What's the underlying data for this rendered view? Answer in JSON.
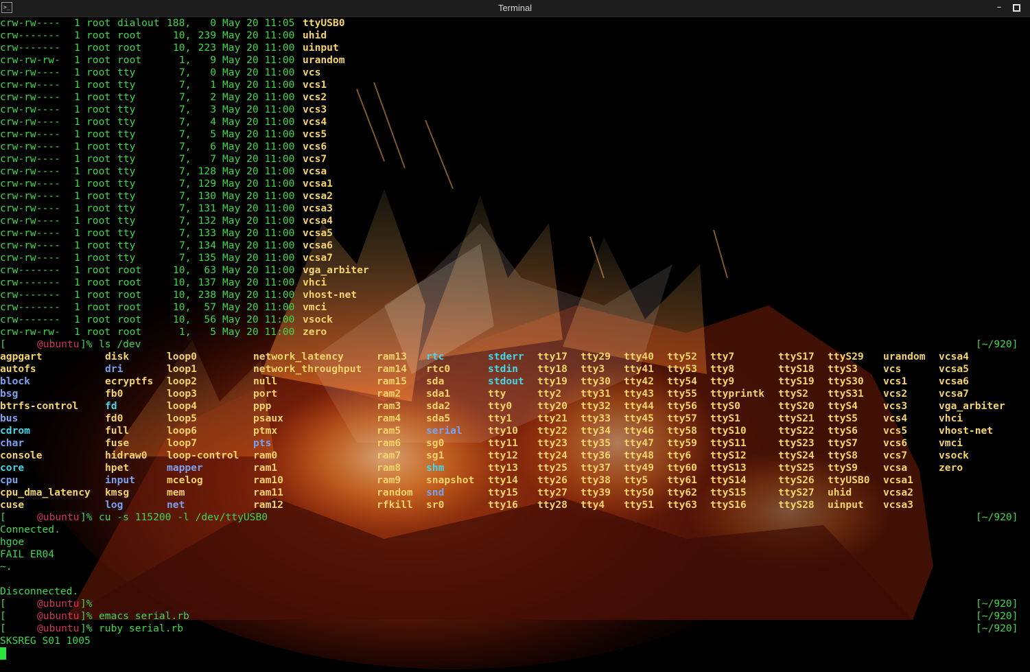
{
  "window": {
    "title": "Terminal",
    "app_icon": "terminal-icon",
    "minimize_glyph": "–"
  },
  "colors": {
    "green": "#3fd84a",
    "yellow": "#f4d36b",
    "blue": "#7aa2f0",
    "cyan": "#47d6e8",
    "magenta": "#d3325d",
    "white": "#f2f2f2"
  },
  "ls_long": [
    {
      "perm": "crw-rw----",
      "links": "1",
      "owner": "root",
      "group": "dialout",
      "major": "188,",
      "minor": "0",
      "date": "May 20 11:05",
      "name": "ttyUSB0"
    },
    {
      "perm": "crw-------",
      "links": "1",
      "owner": "root",
      "group": "root",
      "major": "10,",
      "minor": "239",
      "date": "May 20 11:00",
      "name": "uhid"
    },
    {
      "perm": "crw-------",
      "links": "1",
      "owner": "root",
      "group": "root",
      "major": "10,",
      "minor": "223",
      "date": "May 20 11:00",
      "name": "uinput"
    },
    {
      "perm": "crw-rw-rw-",
      "links": "1",
      "owner": "root",
      "group": "root",
      "major": "1,",
      "minor": "9",
      "date": "May 20 11:00",
      "name": "urandom"
    },
    {
      "perm": "crw-rw----",
      "links": "1",
      "owner": "root",
      "group": "tty",
      "major": "7,",
      "minor": "0",
      "date": "May 20 11:00",
      "name": "vcs"
    },
    {
      "perm": "crw-rw----",
      "links": "1",
      "owner": "root",
      "group": "tty",
      "major": "7,",
      "minor": "1",
      "date": "May 20 11:00",
      "name": "vcs1"
    },
    {
      "perm": "crw-rw----",
      "links": "1",
      "owner": "root",
      "group": "tty",
      "major": "7,",
      "minor": "2",
      "date": "May 20 11:00",
      "name": "vcs2"
    },
    {
      "perm": "crw-rw----",
      "links": "1",
      "owner": "root",
      "group": "tty",
      "major": "7,",
      "minor": "3",
      "date": "May 20 11:00",
      "name": "vcs3"
    },
    {
      "perm": "crw-rw----",
      "links": "1",
      "owner": "root",
      "group": "tty",
      "major": "7,",
      "minor": "4",
      "date": "May 20 11:00",
      "name": "vcs4"
    },
    {
      "perm": "crw-rw----",
      "links": "1",
      "owner": "root",
      "group": "tty",
      "major": "7,",
      "minor": "5",
      "date": "May 20 11:00",
      "name": "vcs5"
    },
    {
      "perm": "crw-rw----",
      "links": "1",
      "owner": "root",
      "group": "tty",
      "major": "7,",
      "minor": "6",
      "date": "May 20 11:00",
      "name": "vcs6"
    },
    {
      "perm": "crw-rw----",
      "links": "1",
      "owner": "root",
      "group": "tty",
      "major": "7,",
      "minor": "7",
      "date": "May 20 11:00",
      "name": "vcs7"
    },
    {
      "perm": "crw-rw----",
      "links": "1",
      "owner": "root",
      "group": "tty",
      "major": "7,",
      "minor": "128",
      "date": "May 20 11:00",
      "name": "vcsa"
    },
    {
      "perm": "crw-rw----",
      "links": "1",
      "owner": "root",
      "group": "tty",
      "major": "7,",
      "minor": "129",
      "date": "May 20 11:00",
      "name": "vcsa1"
    },
    {
      "perm": "crw-rw----",
      "links": "1",
      "owner": "root",
      "group": "tty",
      "major": "7,",
      "minor": "130",
      "date": "May 20 11:00",
      "name": "vcsa2"
    },
    {
      "perm": "crw-rw----",
      "links": "1",
      "owner": "root",
      "group": "tty",
      "major": "7,",
      "minor": "131",
      "date": "May 20 11:00",
      "name": "vcsa3"
    },
    {
      "perm": "crw-rw----",
      "links": "1",
      "owner": "root",
      "group": "tty",
      "major": "7,",
      "minor": "132",
      "date": "May 20 11:00",
      "name": "vcsa4"
    },
    {
      "perm": "crw-rw----",
      "links": "1",
      "owner": "root",
      "group": "tty",
      "major": "7,",
      "minor": "133",
      "date": "May 20 11:00",
      "name": "vcsa5"
    },
    {
      "perm": "crw-rw----",
      "links": "1",
      "owner": "root",
      "group": "tty",
      "major": "7,",
      "minor": "134",
      "date": "May 20 11:00",
      "name": "vcsa6"
    },
    {
      "perm": "crw-rw----",
      "links": "1",
      "owner": "root",
      "group": "tty",
      "major": "7,",
      "minor": "135",
      "date": "May 20 11:00",
      "name": "vcsa7"
    },
    {
      "perm": "crw-------",
      "links": "1",
      "owner": "root",
      "group": "root",
      "major": "10,",
      "minor": "63",
      "date": "May 20 11:00",
      "name": "vga_arbiter"
    },
    {
      "perm": "crw-------",
      "links": "1",
      "owner": "root",
      "group": "root",
      "major": "10,",
      "minor": "137",
      "date": "May 20 11:00",
      "name": "vhci"
    },
    {
      "perm": "crw-------",
      "links": "1",
      "owner": "root",
      "group": "root",
      "major": "10,",
      "minor": "238",
      "date": "May 20 11:00",
      "name": "vhost-net"
    },
    {
      "perm": "crw-------",
      "links": "1",
      "owner": "root",
      "group": "root",
      "major": "10,",
      "minor": "57",
      "date": "May 20 11:00",
      "name": "vmci"
    },
    {
      "perm": "crw-------",
      "links": "1",
      "owner": "root",
      "group": "root",
      "major": "10,",
      "minor": "56",
      "date": "May 20 11:00",
      "name": "vsock"
    },
    {
      "perm": "crw-rw-rw-",
      "links": "1",
      "owner": "root",
      "group": "root",
      "major": "1,",
      "minor": "5",
      "date": "May 20 11:00",
      "name": "zero"
    }
  ],
  "prompt": {
    "open": "[",
    "host": "@ubuntu",
    "close": "]%",
    "right": "[~/920]"
  },
  "cmd_ls": "ls /dev",
  "ls_grid": [
    [
      [
        "agpgart",
        "y"
      ],
      [
        "disk",
        "y"
      ],
      [
        "loop0",
        "y"
      ],
      [
        "network_latency",
        "y"
      ],
      [
        "ram13",
        "y"
      ],
      [
        "rtc",
        "c"
      ],
      [
        "stderr",
        "c"
      ],
      [
        "tty17",
        "y"
      ],
      [
        "tty29",
        "y"
      ],
      [
        "tty40",
        "y"
      ],
      [
        "tty52",
        "y"
      ],
      [
        "tty7",
        "y"
      ],
      [
        "ttyS17",
        "y"
      ],
      [
        "ttyS29",
        "y"
      ],
      [
        "urandom",
        "y"
      ],
      [
        "vcsa4",
        "y"
      ]
    ],
    [
      [
        "autofs",
        "y"
      ],
      [
        "dri",
        "b"
      ],
      [
        "loop1",
        "y"
      ],
      [
        "network_throughput",
        "y"
      ],
      [
        "ram14",
        "y"
      ],
      [
        "rtc0",
        "y"
      ],
      [
        "stdin",
        "c"
      ],
      [
        "tty18",
        "y"
      ],
      [
        "tty3",
        "y"
      ],
      [
        "tty41",
        "y"
      ],
      [
        "tty53",
        "y"
      ],
      [
        "tty8",
        "y"
      ],
      [
        "ttyS18",
        "y"
      ],
      [
        "ttyS3",
        "y"
      ],
      [
        "vcs",
        "y"
      ],
      [
        "vcsa5",
        "y"
      ]
    ],
    [
      [
        "block",
        "b"
      ],
      [
        "ecryptfs",
        "y"
      ],
      [
        "loop2",
        "y"
      ],
      [
        "null",
        "y"
      ],
      [
        "ram15",
        "y"
      ],
      [
        "sda",
        "y"
      ],
      [
        "stdout",
        "c"
      ],
      [
        "tty19",
        "y"
      ],
      [
        "tty30",
        "y"
      ],
      [
        "tty42",
        "y"
      ],
      [
        "tty54",
        "y"
      ],
      [
        "tty9",
        "y"
      ],
      [
        "ttyS19",
        "y"
      ],
      [
        "ttyS30",
        "y"
      ],
      [
        "vcs1",
        "y"
      ],
      [
        "vcsa6",
        "y"
      ]
    ],
    [
      [
        "bsg",
        "b"
      ],
      [
        "fb0",
        "y"
      ],
      [
        "loop3",
        "y"
      ],
      [
        "port",
        "y"
      ],
      [
        "ram2",
        "y"
      ],
      [
        "sda1",
        "y"
      ],
      [
        "tty",
        "y"
      ],
      [
        "tty2",
        "y"
      ],
      [
        "tty31",
        "y"
      ],
      [
        "tty43",
        "y"
      ],
      [
        "tty55",
        "y"
      ],
      [
        "ttyprintk",
        "y"
      ],
      [
        "ttyS2",
        "y"
      ],
      [
        "ttyS31",
        "y"
      ],
      [
        "vcs2",
        "y"
      ],
      [
        "vcsa7",
        "y"
      ]
    ],
    [
      [
        "btrfs-control",
        "y"
      ],
      [
        "fd",
        "c"
      ],
      [
        "loop4",
        "y"
      ],
      [
        "ppp",
        "y"
      ],
      [
        "ram3",
        "y"
      ],
      [
        "sda2",
        "y"
      ],
      [
        "tty0",
        "y"
      ],
      [
        "tty20",
        "y"
      ],
      [
        "tty32",
        "y"
      ],
      [
        "tty44",
        "y"
      ],
      [
        "tty56",
        "y"
      ],
      [
        "ttyS0",
        "y"
      ],
      [
        "ttyS20",
        "y"
      ],
      [
        "ttyS4",
        "y"
      ],
      [
        "vcs3",
        "y"
      ],
      [
        "vga_arbiter",
        "y"
      ]
    ],
    [
      [
        "bus",
        "b"
      ],
      [
        "fd0",
        "y"
      ],
      [
        "loop5",
        "y"
      ],
      [
        "psaux",
        "y"
      ],
      [
        "ram4",
        "y"
      ],
      [
        "sda5",
        "y"
      ],
      [
        "tty1",
        "y"
      ],
      [
        "tty21",
        "y"
      ],
      [
        "tty33",
        "y"
      ],
      [
        "tty45",
        "y"
      ],
      [
        "tty57",
        "y"
      ],
      [
        "ttyS1",
        "y"
      ],
      [
        "ttyS21",
        "y"
      ],
      [
        "ttyS5",
        "y"
      ],
      [
        "vcs4",
        "y"
      ],
      [
        "vhci",
        "y"
      ]
    ],
    [
      [
        "cdrom",
        "c"
      ],
      [
        "full",
        "y"
      ],
      [
        "loop6",
        "y"
      ],
      [
        "ptmx",
        "y"
      ],
      [
        "ram5",
        "y"
      ],
      [
        "serial",
        "b"
      ],
      [
        "tty10",
        "y"
      ],
      [
        "tty22",
        "y"
      ],
      [
        "tty34",
        "y"
      ],
      [
        "tty46",
        "y"
      ],
      [
        "tty58",
        "y"
      ],
      [
        "ttyS10",
        "y"
      ],
      [
        "ttyS22",
        "y"
      ],
      [
        "ttyS6",
        "y"
      ],
      [
        "vcs5",
        "y"
      ],
      [
        "vhost-net",
        "y"
      ]
    ],
    [
      [
        "char",
        "b"
      ],
      [
        "fuse",
        "y"
      ],
      [
        "loop7",
        "y"
      ],
      [
        "pts",
        "b"
      ],
      [
        "ram6",
        "y"
      ],
      [
        "sg0",
        "y"
      ],
      [
        "tty11",
        "y"
      ],
      [
        "tty23",
        "y"
      ],
      [
        "tty35",
        "y"
      ],
      [
        "tty47",
        "y"
      ],
      [
        "tty59",
        "y"
      ],
      [
        "ttyS11",
        "y"
      ],
      [
        "ttyS23",
        "y"
      ],
      [
        "ttyS7",
        "y"
      ],
      [
        "vcs6",
        "y"
      ],
      [
        "vmci",
        "y"
      ]
    ],
    [
      [
        "console",
        "y"
      ],
      [
        "hidraw0",
        "y"
      ],
      [
        "loop-control",
        "y"
      ],
      [
        "ram0",
        "y"
      ],
      [
        "ram7",
        "y"
      ],
      [
        "sg1",
        "y"
      ],
      [
        "tty12",
        "y"
      ],
      [
        "tty24",
        "y"
      ],
      [
        "tty36",
        "y"
      ],
      [
        "tty48",
        "y"
      ],
      [
        "tty6",
        "y"
      ],
      [
        "ttyS12",
        "y"
      ],
      [
        "ttyS24",
        "y"
      ],
      [
        "ttyS8",
        "y"
      ],
      [
        "vcs7",
        "y"
      ],
      [
        "vsock",
        "y"
      ]
    ],
    [
      [
        "core",
        "c"
      ],
      [
        "hpet",
        "y"
      ],
      [
        "mapper",
        "b"
      ],
      [
        "ram1",
        "y"
      ],
      [
        "ram8",
        "y"
      ],
      [
        "shm",
        "c"
      ],
      [
        "tty13",
        "y"
      ],
      [
        "tty25",
        "y"
      ],
      [
        "tty37",
        "y"
      ],
      [
        "tty49",
        "y"
      ],
      [
        "tty60",
        "y"
      ],
      [
        "ttyS13",
        "y"
      ],
      [
        "ttyS25",
        "y"
      ],
      [
        "ttyS9",
        "y"
      ],
      [
        "vcsa",
        "y"
      ],
      [
        "zero",
        "y"
      ]
    ],
    [
      [
        "cpu",
        "b"
      ],
      [
        "input",
        "b"
      ],
      [
        "mcelog",
        "y"
      ],
      [
        "ram10",
        "y"
      ],
      [
        "ram9",
        "y"
      ],
      [
        "snapshot",
        "y"
      ],
      [
        "tty14",
        "y"
      ],
      [
        "tty26",
        "y"
      ],
      [
        "tty38",
        "y"
      ],
      [
        "tty5",
        "y"
      ],
      [
        "tty61",
        "y"
      ],
      [
        "ttyS14",
        "y"
      ],
      [
        "ttyS26",
        "y"
      ],
      [
        "ttyUSB0",
        "y"
      ],
      [
        "vcsa1",
        "y"
      ],
      [
        "",
        ""
      ]
    ],
    [
      [
        "cpu_dma_latency",
        "y"
      ],
      [
        "kmsg",
        "y"
      ],
      [
        "mem",
        "y"
      ],
      [
        "ram11",
        "y"
      ],
      [
        "random",
        "y"
      ],
      [
        "snd",
        "b"
      ],
      [
        "tty15",
        "y"
      ],
      [
        "tty27",
        "y"
      ],
      [
        "tty39",
        "y"
      ],
      [
        "tty50",
        "y"
      ],
      [
        "tty62",
        "y"
      ],
      [
        "ttyS15",
        "y"
      ],
      [
        "ttyS27",
        "y"
      ],
      [
        "uhid",
        "y"
      ],
      [
        "vcsa2",
        "y"
      ],
      [
        "",
        ""
      ]
    ],
    [
      [
        "cuse",
        "y"
      ],
      [
        "log",
        "b"
      ],
      [
        "net",
        "b"
      ],
      [
        "ram12",
        "y"
      ],
      [
        "rfkill",
        "y"
      ],
      [
        "sr0",
        "y"
      ],
      [
        "tty16",
        "y"
      ],
      [
        "tty28",
        "y"
      ],
      [
        "tty4",
        "y"
      ],
      [
        "tty51",
        "y"
      ],
      [
        "tty63",
        "y"
      ],
      [
        "ttyS16",
        "y"
      ],
      [
        "ttyS28",
        "y"
      ],
      [
        "uinput",
        "y"
      ],
      [
        "vcsa3",
        "y"
      ],
      [
        "",
        ""
      ]
    ]
  ],
  "cmd_cu": "cu -s 115200 -l /dev/ttyUSB0",
  "serial_output": [
    "Connected.",
    "hgoe",
    "FAIL ER04",
    "~.",
    "",
    "Disconnected."
  ],
  "cmd_emacs": "emacs serial.rb",
  "cmd_ruby": "ruby serial.rb",
  "program_output": "SKSREG S01 1005"
}
